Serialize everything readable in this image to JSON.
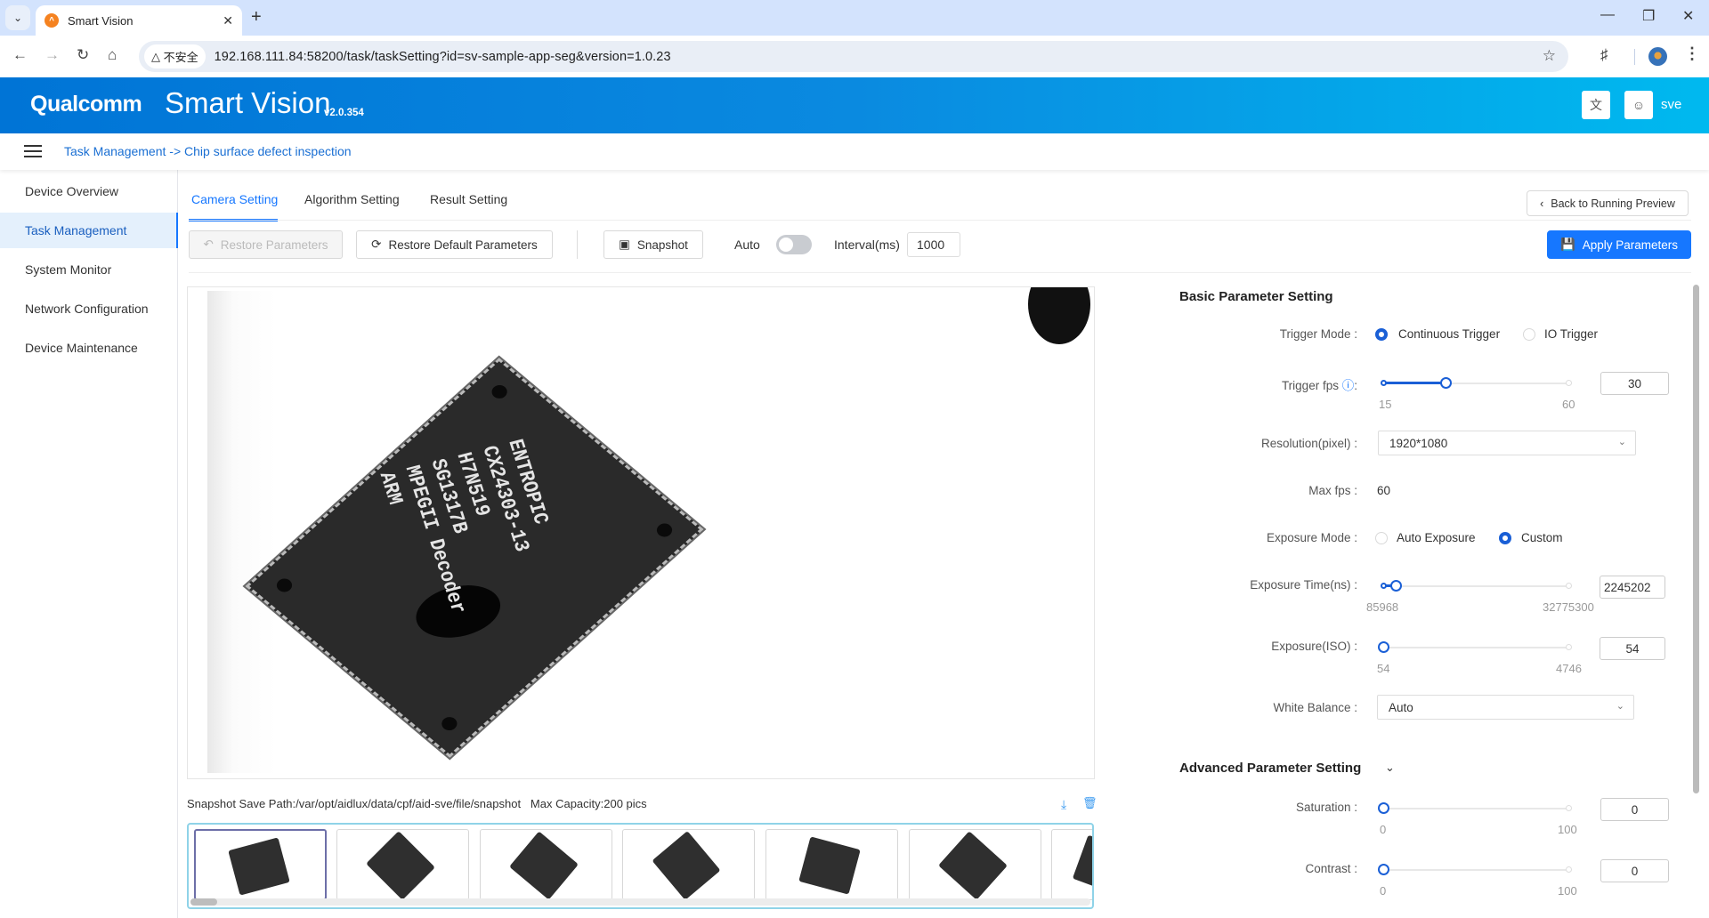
{
  "browser": {
    "tab_title": "Smart Vision",
    "security_label": "不安全",
    "url": "192.168.111.84:58200/task/taskSetting?id=sv-sample-app-seg&version=1.0.23"
  },
  "header": {
    "brand": "Qualcomm",
    "app_title": "Smart Vision",
    "version": "v2.0.354",
    "user": "sve",
    "brand_color": "#0074d6"
  },
  "breadcrumb": "Task Management -> Chip surface defect inspection",
  "sidebar": {
    "items": [
      {
        "label": "Device Overview",
        "active": false
      },
      {
        "label": "Task Management",
        "active": true
      },
      {
        "label": "System Monitor",
        "active": false
      },
      {
        "label": "Network Configuration",
        "active": false
      },
      {
        "label": "Device Maintenance",
        "active": false
      }
    ]
  },
  "tabs": [
    {
      "label": "Camera Setting",
      "active": true
    },
    {
      "label": "Algorithm Setting",
      "active": false
    },
    {
      "label": "Result Setting",
      "active": false
    }
  ],
  "toolbar": {
    "back_label": "Back to Running Preview",
    "restore_label": "Restore Parameters",
    "restore_default_label": "Restore Default Parameters",
    "snapshot_label": "Snapshot",
    "auto_label": "Auto",
    "auto_on": false,
    "interval_label": "Interval(ms)",
    "interval_value": "1000",
    "apply_label": "Apply Parameters"
  },
  "preview": {
    "chip_text": "ENTROPIC\nCX24303-13\nH7N519\nSG1317B\nMPEGII Decoder\nARM"
  },
  "snapshot": {
    "save_path": "Snapshot Save Path:/var/opt/aidlux/data/cpf/aid-sve/file/snapshot   Max Capacity:200 pics",
    "thumbnail_count_visible": 7,
    "selected_index": 0
  },
  "basic": {
    "title": "Basic Parameter Setting",
    "trigger_mode": {
      "label": "Trigger Mode :",
      "options": [
        "Continuous Trigger",
        "IO Trigger"
      ],
      "selected": "Continuous Trigger"
    },
    "trigger_fps": {
      "label": "Trigger fps",
      "colon": ":",
      "min": "15",
      "max": "60",
      "value": "30",
      "min_num": 15,
      "max_num": 60,
      "num": 30
    },
    "resolution": {
      "label": "Resolution(pixel) :",
      "value": "1920*1080"
    },
    "max_fps": {
      "label": "Max fps :",
      "value": "60"
    },
    "exposure_mode": {
      "label": "Exposure Mode :",
      "options": [
        "Auto Exposure",
        "Custom"
      ],
      "selected": "Custom"
    },
    "exposure_time": {
      "label": "Exposure Time(ns) :",
      "min": "85968",
      "max": "32775300",
      "value": "2245202",
      "min_num": 85968,
      "max_num": 32775300,
      "num": 2245202
    },
    "exposure_iso": {
      "label": "Exposure(ISO) :",
      "min": "54",
      "max": "4746",
      "value": "54",
      "min_num": 54,
      "max_num": 4746,
      "num": 54
    },
    "white_balance": {
      "label": "White Balance :",
      "value": "Auto"
    }
  },
  "advanced": {
    "title": "Advanced Parameter Setting",
    "saturation": {
      "label": "Saturation :",
      "min": "0",
      "max": "100",
      "value": "0",
      "min_num": 0,
      "max_num": 100,
      "num": 0
    },
    "contrast": {
      "label": "Contrast :",
      "min": "0",
      "max": "100",
      "value": "0",
      "min_num": 0,
      "max_num": 100,
      "num": 0
    }
  }
}
